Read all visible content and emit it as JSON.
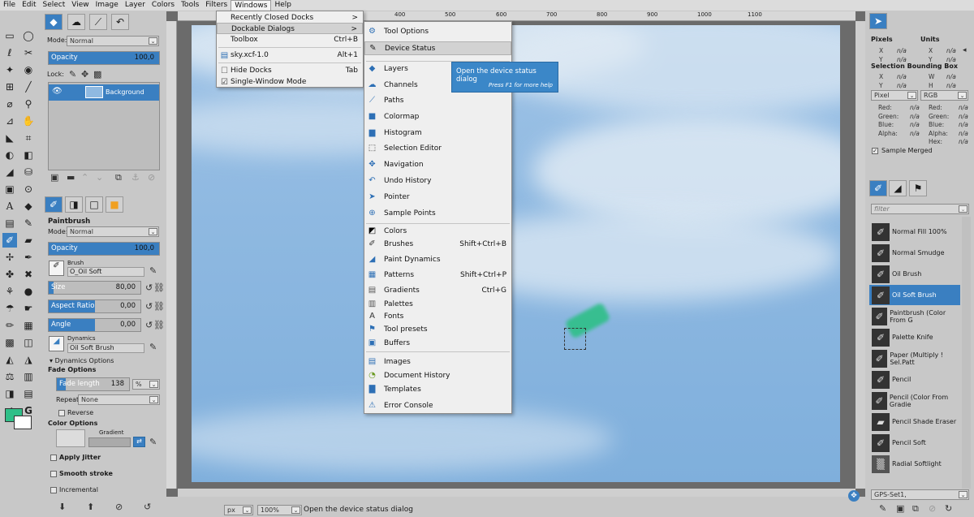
{
  "menubar": {
    "items": [
      "File",
      "Edit",
      "Select",
      "View",
      "Image",
      "Layer",
      "Colors",
      "Tools",
      "Filters",
      "Windows",
      "Help"
    ]
  },
  "layers_panel": {
    "mode_label": "Mode:",
    "mode_value": "Normal",
    "opacity_label": "Opacity",
    "opacity_value": "100,0",
    "opacity_fraction": 1.0,
    "lock_label": "Lock:",
    "layer_name": "Background"
  },
  "tool_options": {
    "title": "Paintbrush",
    "mode_label": "Mode:",
    "mode_value": "Normal",
    "opacity_label": "Opacity",
    "opacity_value": "100,0",
    "opacity_fraction": 1.0,
    "brush_label": "Brush",
    "brush_value": "O_Oil Soft",
    "size_label": "Size",
    "size_value": "80,00",
    "size_fraction": 0.05,
    "aspect_label": "Aspect Ratio",
    "aspect_value": "0,00",
    "aspect_fraction": 0.5,
    "angle_label": "Angle",
    "angle_value": "0,00",
    "angle_fraction": 0.5,
    "dynamics_label": "Dynamics",
    "dynamics_value": "Oil Soft Brush",
    "dynamics_options": "Dynamics Options",
    "fade_options": "Fade Options",
    "fade_length_label": "Fade length",
    "fade_length_value": "138",
    "fade_unit": "%",
    "fade_fraction": 0.12,
    "repeat_label": "Repeat:",
    "repeat_value": "None",
    "reverse_label": "Reverse",
    "color_options": "Color Options",
    "gradient_label": "Gradient",
    "apply_jitter": "Apply Jitter",
    "smooth_stroke": "Smooth stroke",
    "incremental": "Incremental"
  },
  "windows_menu": {
    "items": [
      {
        "label": "Recently Closed Docks",
        "shortcut": "",
        "arrow": ">"
      },
      {
        "label": "Dockable Dialogs",
        "shortcut": "",
        "arrow": ">"
      },
      {
        "label": "Toolbox",
        "shortcut": "Ctrl+B"
      },
      {
        "label": "sky.xcf-1.0",
        "shortcut": "Alt+1"
      },
      {
        "label": "Hide Docks",
        "shortcut": "Tab"
      },
      {
        "label": "Single-Window Mode",
        "shortcut": ""
      }
    ]
  },
  "dockable_menu": {
    "items": [
      {
        "label": "Tool Options",
        "shortcut": "",
        "icon": "tool-options-icon"
      },
      {
        "label": "Device Status",
        "shortcut": "",
        "icon": "device-status-icon"
      },
      {
        "label": "Layers",
        "shortcut": "",
        "icon": "layers-icon"
      },
      {
        "label": "Channels",
        "shortcut": "",
        "icon": "channels-icon"
      },
      {
        "label": "Paths",
        "shortcut": "",
        "icon": "paths-icon"
      },
      {
        "label": "Colormap",
        "shortcut": "",
        "icon": "colormap-icon"
      },
      {
        "label": "Histogram",
        "shortcut": "",
        "icon": "histogram-icon"
      },
      {
        "label": "Selection Editor",
        "shortcut": "",
        "icon": "selection-editor-icon"
      },
      {
        "label": "Navigation",
        "shortcut": "",
        "icon": "navigation-icon"
      },
      {
        "label": "Undo History",
        "shortcut": "",
        "icon": "undo-history-icon"
      },
      {
        "label": "Pointer",
        "shortcut": "",
        "icon": "pointer-icon"
      },
      {
        "label": "Sample Points",
        "shortcut": "",
        "icon": "sample-points-icon"
      },
      {
        "label": "Colors",
        "shortcut": "",
        "icon": "colors-icon"
      },
      {
        "label": "Brushes",
        "shortcut": "Shift+Ctrl+B",
        "icon": "brushes-icon"
      },
      {
        "label": "Paint Dynamics",
        "shortcut": "",
        "icon": "paint-dynamics-icon"
      },
      {
        "label": "Patterns",
        "shortcut": "Shift+Ctrl+P",
        "icon": "patterns-icon"
      },
      {
        "label": "Gradients",
        "shortcut": "Ctrl+G",
        "icon": "gradients-icon"
      },
      {
        "label": "Palettes",
        "shortcut": "",
        "icon": "palettes-icon"
      },
      {
        "label": "Fonts",
        "shortcut": "",
        "icon": "fonts-icon"
      },
      {
        "label": "Tool presets",
        "shortcut": "",
        "icon": "tool-presets-icon"
      },
      {
        "label": "Buffers",
        "shortcut": "",
        "icon": "buffers-icon"
      },
      {
        "label": "Images",
        "shortcut": "",
        "icon": "images-icon"
      },
      {
        "label": "Document History",
        "shortcut": "",
        "icon": "document-history-icon"
      },
      {
        "label": "Templates",
        "shortcut": "",
        "icon": "templates-icon"
      },
      {
        "label": "Error Console",
        "shortcut": "",
        "icon": "error-console-icon"
      }
    ]
  },
  "tooltip": {
    "title": "Open the device status dialog",
    "hint": "Press F1 for more help"
  },
  "pointer_panel": {
    "pixels": "Pixels",
    "units": "Units",
    "x": "X",
    "y": "Y",
    "w": "W",
    "h": "H",
    "na": "n/a",
    "bbox": "Selection Bounding Box",
    "unit_value": "Pixel",
    "color_model": "RGB",
    "red": "Red:",
    "green": "Green:",
    "blue": "Blue:",
    "alpha": "Alpha:",
    "hex": "Hex:",
    "sample_merged": "Sample Merged"
  },
  "brushes_panel": {
    "filter_placeholder": "filter",
    "items": [
      "Normal Fill 100%",
      "Normal Smudge",
      "Oil Brush",
      "Oil Soft Brush",
      "Paintbrush (Color From G",
      "Palette Knife",
      "Paper (Multiply ! Sel.Patt",
      "Pencil",
      "Pencil (Color From Gradie",
      "Pencil Shade Eraser",
      "Pencil Soft",
      "Radial Softlight"
    ],
    "selected_index": 3,
    "footer_value": "GPS-Set1,"
  },
  "ruler": {
    "labels": [
      "400",
      "500",
      "600",
      "700",
      "800",
      "900",
      "1000",
      "1100"
    ]
  },
  "statusbar": {
    "unit": "px",
    "zoom": "100",
    "zoom_unit": "%",
    "message": "Open the device status dialog"
  },
  "colors": {
    "foreground": "#2fbf88",
    "background": "#ffffff",
    "accent": "#3a7fc1"
  }
}
